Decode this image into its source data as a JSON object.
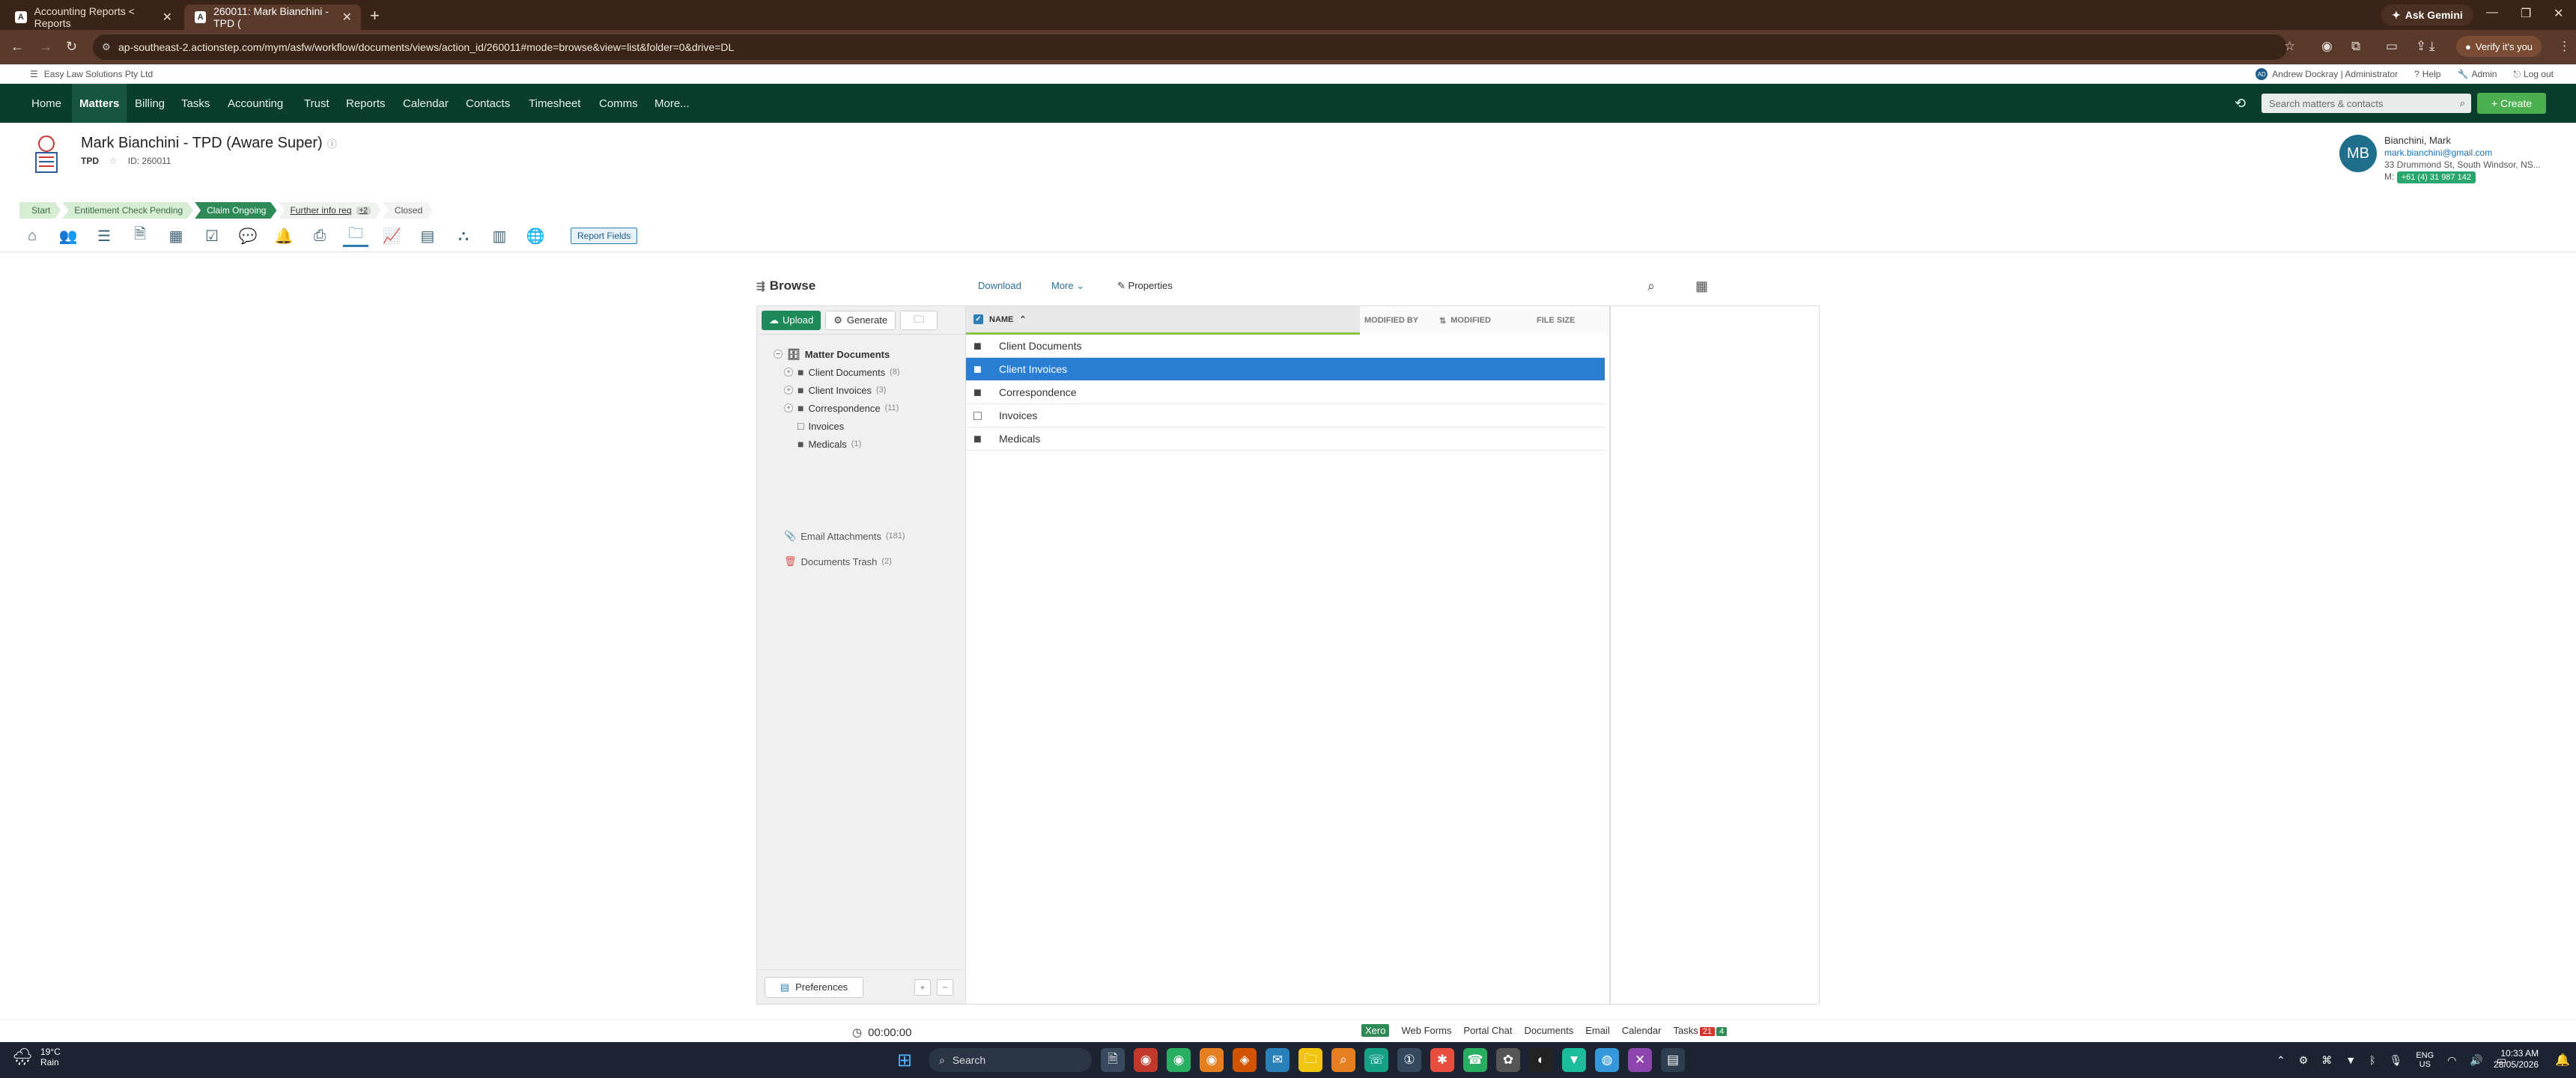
{
  "browser": {
    "tabs": [
      {
        "title": "Accounting Reports < Reports",
        "favicon": "A"
      },
      {
        "title": "260011: Mark Bianchini - TPD (",
        "favicon": "A"
      }
    ],
    "gemini_label": "Ask Gemini",
    "url": "ap-southeast-2.actionstep.com/mym/asfw/workflow/documents/views/action_id/260011#mode=browse&view=list&folder=0&drive=DL",
    "verify_label": "Verify it's you"
  },
  "app": {
    "firm_name": "Easy Law Solutions Pty Ltd",
    "user": "Andrew Dockray | Administrator",
    "user_initials": "AD",
    "help_label": "Help",
    "admin_label": "Admin",
    "logout_label": "Log out",
    "nav": [
      "Home",
      "Matters",
      "Billing",
      "Tasks",
      "Accounting",
      "Trust",
      "Reports",
      "Calendar",
      "Contacts",
      "Timesheet",
      "Comms",
      "More..."
    ],
    "search_placeholder": "Search matters & contacts",
    "create_label": "+ Create"
  },
  "matter": {
    "title": "Mark Bianchini - TPD (Aware Super)",
    "type": "TPD",
    "id_label": "ID: 260011",
    "steps": {
      "start": "Start",
      "pending": "Entitlement Check Pending",
      "current": "Claim Ongoing",
      "next": "Further info req",
      "next_more": "+2",
      "closed": "Closed"
    },
    "report_fields_label": "Report Fields",
    "contact": {
      "initials": "MB",
      "name": "Bianchini, Mark",
      "email": "mark.bianchini@gmail.com",
      "address": "33 Drummond St, South Windsor, NS...",
      "phone_prefix": "M:",
      "phone": "+61 (4) 31 987 142"
    }
  },
  "documents": {
    "browse_title": "Browse",
    "download_label": "Download",
    "more_label": "More",
    "properties_label": "Properties",
    "upload_label": "Upload",
    "generate_label": "Generate",
    "tree_root": "Matter Documents",
    "tree": [
      {
        "name": "Client Documents",
        "count": "(8)"
      },
      {
        "name": "Client Invoices",
        "count": "(3)"
      },
      {
        "name": "Correspondence",
        "count": "(11)"
      },
      {
        "name": "Invoices",
        "count": ""
      },
      {
        "name": "Medicals",
        "count": "(1)"
      }
    ],
    "email_attachments": {
      "name": "Email Attachments",
      "count": "(181)"
    },
    "trash": {
      "name": "Documents Trash",
      "count": "(2)"
    },
    "preferences_label": "Preferences",
    "columns": {
      "name": "NAME",
      "modified_by": "MODIFIED BY",
      "modified": "MODIFIED",
      "file_size": "FILE SIZE"
    },
    "rows": [
      "Client Documents",
      "Client Invoices",
      "Correspondence",
      "Invoices",
      "Medicals"
    ]
  },
  "footer": {
    "timer": "00:00:00",
    "links": {
      "xero": "Xero",
      "web_forms": "Web Forms",
      "portal_chat": "Portal Chat",
      "documents": "Documents",
      "email": "Email",
      "calendar": "Calendar",
      "tasks": "Tasks"
    },
    "tasks_overdue": "21",
    "tasks_due": "4"
  },
  "taskbar": {
    "temp": "19°C",
    "weather": "Rain",
    "search_label": "Search",
    "lang": "ENG",
    "region": "US",
    "time": "10:33 AM",
    "date": "28/05/2026"
  }
}
